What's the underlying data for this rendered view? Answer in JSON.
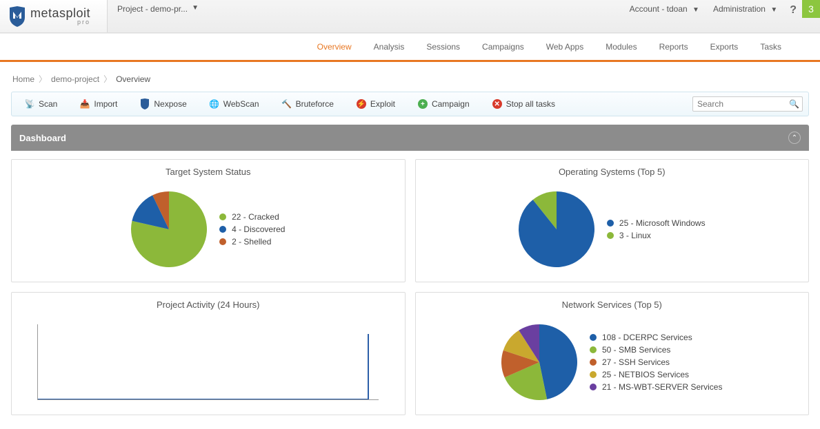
{
  "header": {
    "brand_main": "metasploit",
    "brand_sub": "pro",
    "project_selector": "Project - demo-pr...",
    "account_label": "Account - tdoan",
    "admin_label": "Administration",
    "notif_count": "3"
  },
  "nav": {
    "tabs": [
      "Overview",
      "Analysis",
      "Sessions",
      "Campaigns",
      "Web Apps",
      "Modules",
      "Reports",
      "Exports",
      "Tasks"
    ],
    "active": 0
  },
  "breadcrumb": {
    "items": [
      "Home",
      "demo-project",
      "Overview"
    ]
  },
  "toolbar": {
    "buttons": [
      {
        "label": "Scan",
        "icon": "scan-icon"
      },
      {
        "label": "Import",
        "icon": "import-icon"
      },
      {
        "label": "Nexpose",
        "icon": "nexpose-icon"
      },
      {
        "label": "WebScan",
        "icon": "webscan-icon"
      },
      {
        "label": "Bruteforce",
        "icon": "bruteforce-icon"
      },
      {
        "label": "Exploit",
        "icon": "exploit-icon"
      },
      {
        "label": "Campaign",
        "icon": "campaign-icon"
      },
      {
        "label": "Stop all tasks",
        "icon": "stop-icon"
      }
    ],
    "search_placeholder": "Search"
  },
  "dashboard": {
    "title": "Dashboard"
  },
  "chart_data": [
    {
      "id": "target_status",
      "title": "Target System Status",
      "type": "pie",
      "series": [
        {
          "name": "Cracked",
          "value": 22,
          "color": "#8cb83a"
        },
        {
          "name": "Discovered",
          "value": 4,
          "color": "#1e5fa8"
        },
        {
          "name": "Shelled",
          "value": 2,
          "color": "#c0602c"
        }
      ]
    },
    {
      "id": "os_top5",
      "title": "Operating Systems (Top 5)",
      "type": "pie",
      "series": [
        {
          "name": "Microsoft Windows",
          "value": 25,
          "color": "#1e5fa8"
        },
        {
          "name": "Linux",
          "value": 3,
          "color": "#8cb83a"
        }
      ]
    },
    {
      "id": "activity",
      "title": "Project Activity (24 Hours)",
      "type": "line",
      "x_range": [
        0,
        24
      ],
      "y_range": [
        0,
        1
      ],
      "note": "flat at 0 with single spike near x≈23"
    },
    {
      "id": "net_services",
      "title": "Network Services (Top 5)",
      "type": "pie",
      "series": [
        {
          "name": "DCERPC Services",
          "value": 108,
          "color": "#1e5fa8"
        },
        {
          "name": "SMB Services",
          "value": 50,
          "color": "#8cb83a"
        },
        {
          "name": "SSH Services",
          "value": 27,
          "color": "#c0602c"
        },
        {
          "name": "NETBIOS Services",
          "value": 25,
          "color": "#c9a82e"
        },
        {
          "name": "MS-WBT-SERVER Services",
          "value": 21,
          "color": "#6a3fa0"
        }
      ]
    }
  ]
}
